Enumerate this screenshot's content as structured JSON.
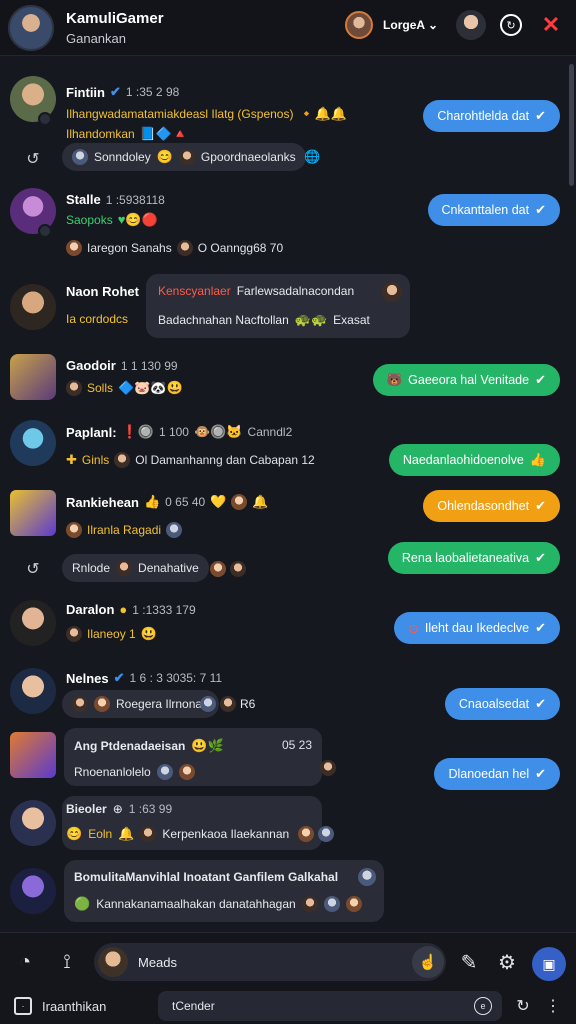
{
  "header": {
    "title": "KamuliGamer",
    "subtitle": "Ganankan",
    "dropdown": "LorgeA",
    "icons": [
      "avatar",
      "refresh-icon",
      "close-icon"
    ]
  },
  "rows": [
    {
      "name": "Fintiin",
      "time": "1 :35 2 98",
      "line2": "Ilhangwadamatamiakdeasl Ilatg (Gspenos)",
      "line3": "Ilhandomkan",
      "pill": "Charohtlelda dat",
      "pill_color": "#3f8fe8"
    },
    {
      "reaction": "Sonndoley",
      "reaction2": "Gpoordnaeolanks"
    },
    {
      "name": "Stalle",
      "time": "1 :5938118",
      "line2": "Saopoks",
      "line3": "Iaregon Sanahs",
      "line3b": "O Oanngg68 70",
      "pill": "Cnkanttalen dat",
      "pill_color": "#3f8fe8"
    },
    {
      "name": "Naon Rohet",
      "line3": "Ia cordodcs",
      "card_a": "Kenscyanlaer",
      "card_b": "Farlewsadalnacondan",
      "card_c": "Badachnahan Nacftollan",
      "card_d": "Exasat"
    },
    {
      "name": "Gaodoir",
      "time": "1 1 130 99",
      "line2": "Solls",
      "pill": "Gaeeora hal Venitade",
      "pill_color": "#25b567"
    },
    {
      "name": "Paplanl:",
      "time": "1 100",
      "tag": "Canndl2",
      "line2": "Ginls",
      "line2b": "Ol Damanhanng dan Cabapan 12",
      "pill": "Naedanlaohidoenolve",
      "pill_color": "#25b567"
    },
    {
      "name": "Rankiehean",
      "time": "0 65 40",
      "line2": "Ilranla Ragadi",
      "pill": "Ohlendasondhet",
      "pill_color": "#f0a012"
    },
    {
      "reaction": "Rnlode",
      "reaction2": "Denahative",
      "pill": "Rena laobalietaneativa",
      "pill_color": "#25b567"
    },
    {
      "name": "Daralon",
      "time": "1 :1333 179",
      "line2": "Ilaneoy 1",
      "pill": "Ileht dau Ikedeclve",
      "pill_color": "#3f8fe8"
    },
    {
      "name": "Nelnes",
      "time": "1 6 : 3 3035: 7 11",
      "line2": "Roegera Ilrnonan",
      "line2b": "R6",
      "pill": "Cnaoalsedat",
      "pill_color": "#3f8fe8"
    },
    {
      "name": "Ang Ptdenadaeisan",
      "time": "05 23",
      "line2": "Rnoenanlolelo",
      "pill": "Dlanoedan hel",
      "pill_color": "#3f8fe8"
    },
    {
      "name": "Bieoler",
      "time": "1 :63 99",
      "line2": "Eoln",
      "line2b": "Kerpenkaoa Ilaekannan",
      "pill": ""
    },
    {
      "card_a": "BomulitaManvihlal Inoatant Ganfilem Galkahal",
      "card_b": "Kannakanamaalhakan danatahhagan"
    }
  ],
  "composer": {
    "placeholder": "Meads"
  },
  "footer": {
    "label": "Iraanthikan",
    "search": "tCender"
  }
}
